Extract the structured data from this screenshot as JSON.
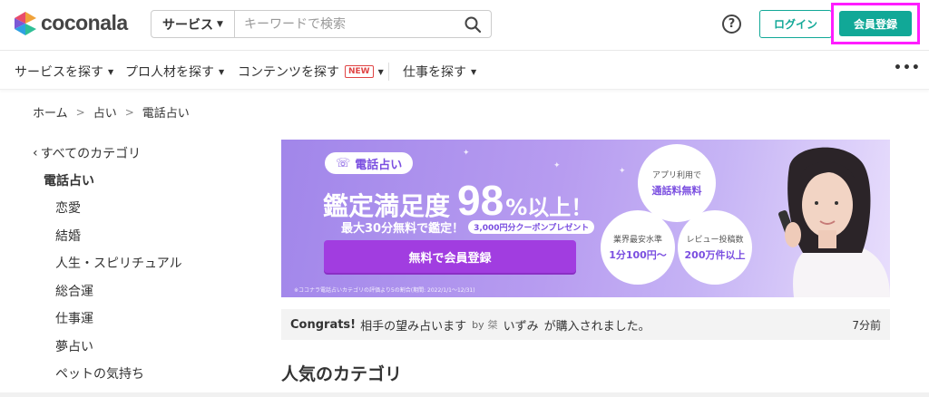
{
  "header": {
    "logo_text": "coconala",
    "search": {
      "category": "サービス",
      "placeholder": "キーワードで検索"
    },
    "help_symbol": "?",
    "login_label": "ログイン",
    "register_label": "会員登録",
    "accent_color": "#11a897",
    "highlight_color": "#ff1dff"
  },
  "nav": {
    "items": [
      {
        "label": "サービスを探す"
      },
      {
        "label": "プロ人材を探す"
      },
      {
        "label": "コンテンツを探す",
        "badge": "NEW"
      },
      {
        "label": "仕事を探す"
      }
    ],
    "more_label": "•••"
  },
  "breadcrumb": [
    "ホーム",
    "占い",
    "電話占い"
  ],
  "sidebar": {
    "back_label": "すべてのカテゴリ",
    "current": "電話占い",
    "items": [
      "恋愛",
      "結婚",
      "人生・スピリチュアル",
      "総合運",
      "仕事運",
      "夢占い",
      "ペットの気持ち"
    ]
  },
  "banner": {
    "tag": "電話占い",
    "headline_1": "鑑定満足度",
    "headline_num": "98",
    "headline_2": "%以上！",
    "sub_text": "最大30分無料で鑑定！",
    "coupon": "3,000円分クーポンプレゼント",
    "cta": "無料で会員登録",
    "note": "※ココナラ電話占いカテゴリの評価より5の割合(期間: 2022/1/1〜12/31)",
    "badges": [
      {
        "line1": "アプリ利用で",
        "line2": "通話料無料"
      },
      {
        "line1": "業界最安水準",
        "line2": "1分100円〜"
      },
      {
        "line1": "レビュー投稿数",
        "line2": "200万件以上"
      }
    ]
  },
  "activity": {
    "prefix": "Congrats!",
    "text": "相手の望み占います",
    "by": "by",
    "user_mark": "桀",
    "user": "いずみ",
    "suffix": "が購入されました。",
    "time": "7分前"
  },
  "section": {
    "title": "人気のカテゴリ"
  }
}
